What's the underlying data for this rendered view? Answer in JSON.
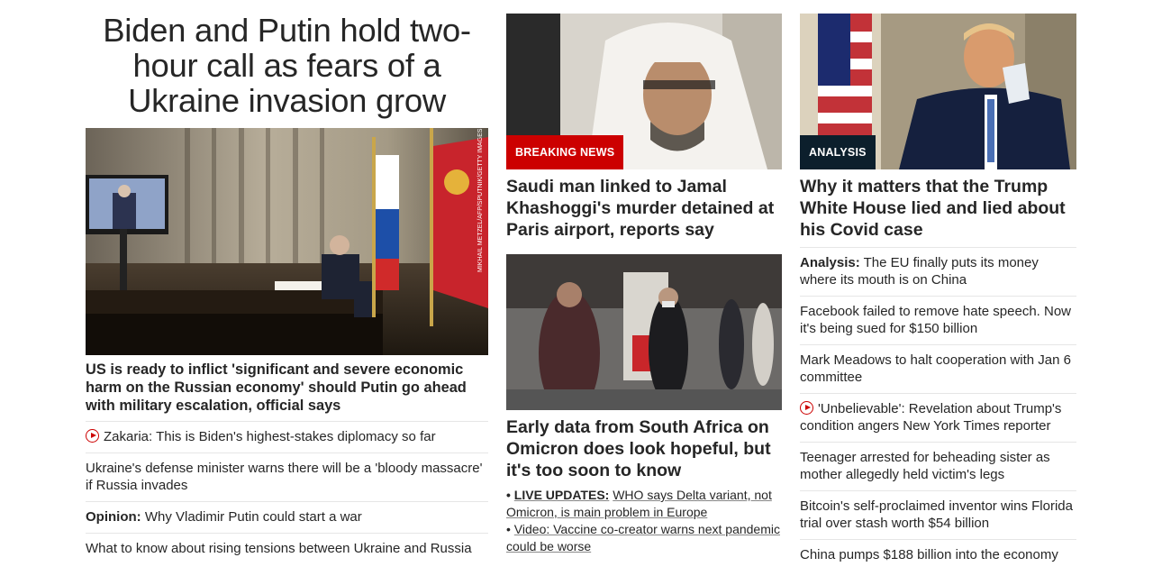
{
  "left": {
    "headline": "Biden and Putin hold two-hour call as fears of a Ukraine invasion grow",
    "photo_credit": "MIKHAIL METZEL/AFP/SPUTNIK/GETTY IMAGES",
    "subheadline": "US is ready to inflict 'significant and severe economic harm on the Russian economy' should Putin go ahead with military escalation, official says",
    "items": [
      {
        "prefix": "",
        "text": "Zakaria: This is Biden's highest-stakes diplomacy so far",
        "icon": "play-icon"
      },
      {
        "prefix": "",
        "text": "Ukraine's defense minister warns there will be a 'bloody massacre' if Russia invades",
        "icon": ""
      },
      {
        "prefix": "Opinion:",
        "text": "Why Vladimir Putin could start a war",
        "icon": ""
      },
      {
        "prefix": "",
        "text": "What to know about rising tensions between Ukraine and Russia",
        "icon": ""
      }
    ]
  },
  "middle": {
    "card1": {
      "badge": "BREAKING NEWS",
      "title": "Saudi man linked to Jamal Khashoggi's murder detained at Paris airport, reports say"
    },
    "card2": {
      "title": "Early data from South Africa on Omicron does look hopeful, but it's too soon to know",
      "bullet1_prefix": "LIVE UPDATES:",
      "bullet1_text": "WHO says Delta variant, not Omicron, is main problem in Europe",
      "bullet2_text": "Video: Vaccine co-creator warns next pandemic could be worse"
    }
  },
  "right": {
    "badge": "ANALYSIS",
    "title": "Why it matters that the Trump White House lied and lied about his Covid case",
    "items": [
      {
        "prefix": "Analysis:",
        "text": "The EU finally puts its money where its mouth is on China",
        "icon": ""
      },
      {
        "prefix": "",
        "text": "Facebook failed to remove hate speech. Now it's being sued for $150 billion",
        "icon": ""
      },
      {
        "prefix": "",
        "text": "Mark Meadows to halt cooperation with Jan 6 committee",
        "icon": ""
      },
      {
        "prefix": "",
        "text": "'Unbelievable': Revelation about Trump's condition angers New York Times reporter",
        "icon": "play-icon"
      },
      {
        "prefix": "",
        "text": "Teenager arrested for beheading sister as mother allegedly held victim's legs",
        "icon": ""
      },
      {
        "prefix": "",
        "text": "Bitcoin's self-proclaimed inventor wins Florida trial over stash worth $54 billion",
        "icon": ""
      },
      {
        "prefix": "",
        "text": "China pumps $188 billion into the economy",
        "icon": ""
      }
    ]
  }
}
